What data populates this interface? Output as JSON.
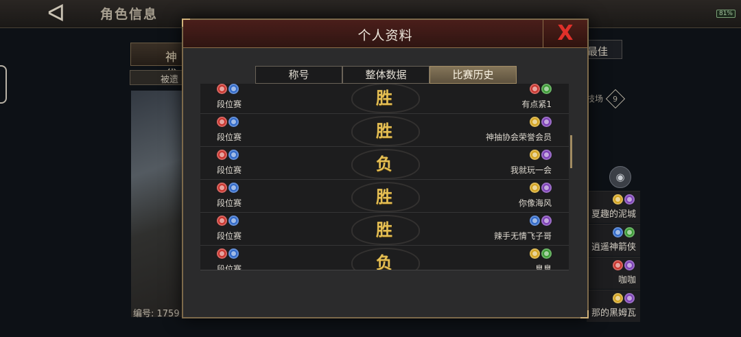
{
  "topbar": {
    "back_glyph": "ᐊ",
    "title": "角色信息",
    "battery": "81%"
  },
  "left_panel": {
    "tab_label": "神代",
    "tag_label": "被遗",
    "serial_label": "编号: 1759"
  },
  "right_panel": {
    "best_label": "最佳",
    "arena_label": "技场",
    "arena_level": "9",
    "eye_glyph": "◉",
    "rows": [
      {
        "name": "夏趣的泥城",
        "icons": [
          "yellow",
          "purple"
        ]
      },
      {
        "name": "逍遥神箭侠",
        "icons": [
          "blue",
          "green"
        ]
      },
      {
        "name": "咖咖",
        "icons": [
          "red",
          "purple"
        ]
      },
      {
        "name": "那的黑姆瓦",
        "icons": [
          "yellow",
          "purple"
        ]
      }
    ]
  },
  "modal": {
    "title": "个人资料",
    "close_glyph": "X",
    "tabs": [
      {
        "label": "称号",
        "active": false
      },
      {
        "label": "整体数据",
        "active": false
      },
      {
        "label": "比赛历史",
        "active": true
      }
    ],
    "matches": [
      {
        "mode": "段位赛",
        "result": "胜",
        "opponent": "有点紧1",
        "my_icons": [
          "red",
          "blue"
        ],
        "opp_icons": [
          "red",
          "green"
        ]
      },
      {
        "mode": "段位赛",
        "result": "胜",
        "opponent": "神抽协会荣誉会员",
        "my_icons": [
          "red",
          "blue"
        ],
        "opp_icons": [
          "yellow",
          "purple"
        ]
      },
      {
        "mode": "段位赛",
        "result": "负",
        "opponent": "我就玩一会",
        "my_icons": [
          "red",
          "blue"
        ],
        "opp_icons": [
          "yellow",
          "purple"
        ]
      },
      {
        "mode": "段位赛",
        "result": "胜",
        "opponent": "你像海风",
        "my_icons": [
          "red",
          "blue"
        ],
        "opp_icons": [
          "yellow",
          "purple"
        ]
      },
      {
        "mode": "段位赛",
        "result": "胜",
        "opponent": "辣手无情飞子哥",
        "my_icons": [
          "red",
          "blue"
        ],
        "opp_icons": [
          "blue",
          "purple"
        ]
      },
      {
        "mode": "段位赛",
        "result": "负",
        "opponent": "臯臯",
        "my_icons": [
          "red",
          "blue"
        ],
        "opp_icons": [
          "yellow",
          "green"
        ]
      }
    ]
  }
}
